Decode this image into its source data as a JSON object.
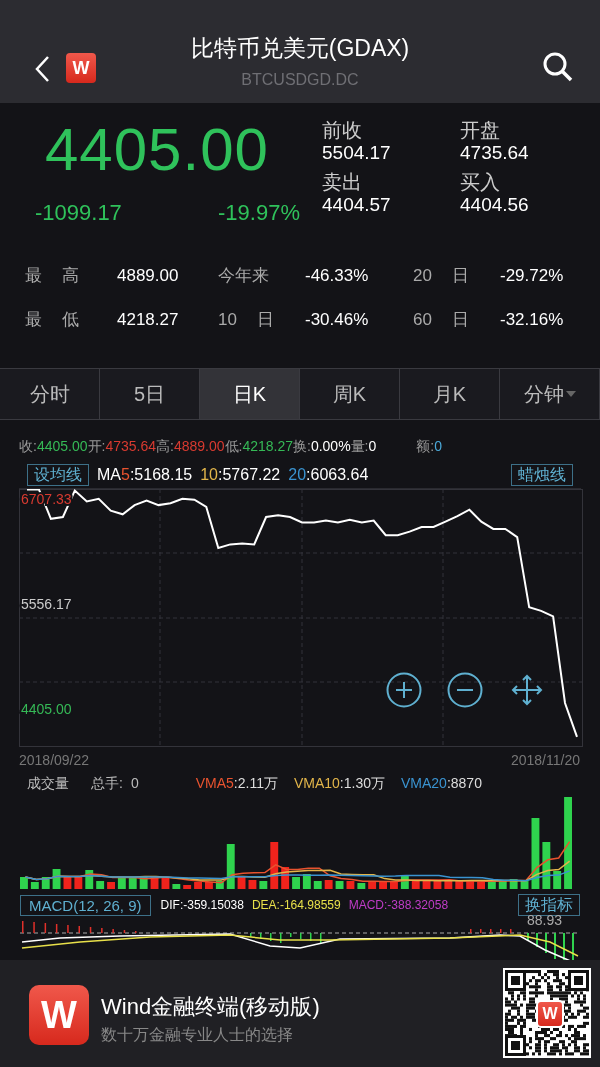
{
  "header": {
    "logo": "W",
    "title": "比特币兑美元(GDAX)",
    "code": "BTCUSDGD.DC"
  },
  "quote": {
    "price": "4405.00",
    "change": "-1099.17",
    "change_pct": "-19.97%",
    "fields": [
      {
        "label": "前收",
        "value": "5504.17"
      },
      {
        "label": "开盘",
        "value": "4735.64"
      },
      {
        "label": "卖出",
        "value": "4404.57"
      },
      {
        "label": "买入",
        "value": "4404.56"
      }
    ]
  },
  "stats": [
    {
      "label": "最 高",
      "value": "4889.00"
    },
    {
      "label": "今年来",
      "value": "-46.33%"
    },
    {
      "label": "20 日",
      "value": "-29.72%"
    },
    {
      "label": "最 低",
      "value": "4218.27"
    },
    {
      "label": "10 日",
      "value": "-30.46%"
    },
    {
      "label": "60 日",
      "value": "-32.16%"
    }
  ],
  "tabs": [
    {
      "label": "分时",
      "selected": false,
      "has_menu": false
    },
    {
      "label": "5日",
      "selected": false,
      "has_menu": false
    },
    {
      "label": "日K",
      "selected": true,
      "has_menu": false
    },
    {
      "label": "周K",
      "selected": false,
      "has_menu": false
    },
    {
      "label": "月K",
      "selected": false,
      "has_menu": false
    },
    {
      "label": "分钟",
      "selected": false,
      "has_menu": true
    }
  ],
  "summary": [
    {
      "label": "收:",
      "value": "4405.00",
      "color": "#35b956"
    },
    {
      "label": "开:",
      "value": "4735.64",
      "color": "#d83a30"
    },
    {
      "label": "高:",
      "value": "4889.00",
      "color": "#d83a30"
    },
    {
      "label": "低:",
      "value": "4218.27",
      "color": "#35b956"
    },
    {
      "label": "换:",
      "value": "0.00%",
      "color": "#ffffff"
    },
    {
      "label": "量:",
      "value": "0",
      "color": "#ffffff"
    },
    {
      "label": "额:",
      "value": "0",
      "color": "#4aa8d8"
    }
  ],
  "ma_bar": {
    "button": "设均线",
    "prefix": "MA",
    "items": [
      {
        "period": "5",
        "value": ":5168.15",
        "color": "#e8532f"
      },
      {
        "period": "10",
        "value": ":5767.22",
        "color": "#e2b54a"
      },
      {
        "period": "20",
        "value": ":6063.64",
        "color": "#3a93d0"
      }
    ],
    "style_button": "蜡烛线"
  },
  "price_chart": {
    "date_start": "2018/09/22",
    "date_end": "2018/11/20",
    "chart_data": {
      "type": "line",
      "ylim": [
        3988,
        6817
      ],
      "yticks": [
        {
          "value": 6707.33,
          "label": "6707.33"
        },
        {
          "value": 5556.17,
          "label": "5556.17"
        },
        {
          "value": 4405,
          "label": "4405.00"
        }
      ],
      "series": [
        {
          "color": "#ffffff",
          "values": [
            6810,
            6810,
            6490,
            6510,
            6800,
            6680,
            6710,
            6580,
            6540,
            6640,
            6690,
            6640,
            6660,
            6710,
            6700,
            6620,
            6170,
            6210,
            6220,
            6210,
            6510,
            6530,
            6510,
            6450,
            6450,
            6470,
            6450,
            6480,
            6450,
            6470,
            6310,
            6310,
            6350,
            6400,
            6400,
            6460,
            6520,
            6590,
            6460,
            6380,
            6380,
            6290,
            5520,
            5480,
            5420,
            4470,
            4100
          ]
        }
      ]
    }
  },
  "volume": {
    "title": "成交量",
    "total_label": "总手:",
    "total": "0",
    "items": [
      {
        "label": "VMA5",
        "value": ":2.11万",
        "color": "#e8532f"
      },
      {
        "label": "VMA10",
        "value": ":1.30万",
        "color": "#e2b54a"
      },
      {
        "label": "VMA20",
        "value": ":8870",
        "color": "#3a93d0"
      }
    ]
  },
  "macd": {
    "button": "MACD(12, 26, 9)",
    "items": [
      {
        "text": "DIF:-359.15038",
        "color": "#ffffff"
      },
      {
        "text": "DEA:-164.98559",
        "color": "#e8e04a"
      },
      {
        "text": "MACD:-388.32058",
        "color": "#c03cc8"
      }
    ],
    "switch_button": "换指标",
    "tick": "88.93"
  },
  "footer": {
    "logo": "W",
    "app_name": "Wind金融终端(移动版)",
    "slogan": "数十万金融专业人士的选择",
    "qr_logo": "W"
  }
}
